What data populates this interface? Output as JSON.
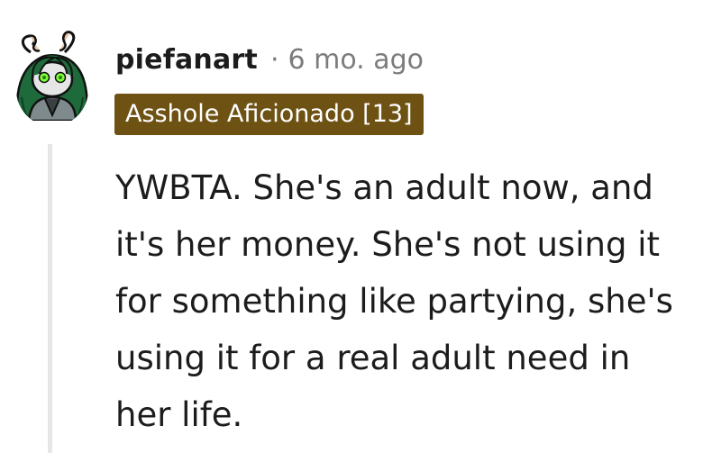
{
  "comment": {
    "author": "piefanart",
    "separator": "·",
    "timestamp": "6 mo. ago",
    "flair": {
      "text": "Asshole Aficionado [13]",
      "background": "#6e5213",
      "color": "#ffffff"
    },
    "body": "YWBTA. She's an adult now, and it's her money. She's not using it for something like partying, she's using it for a real adult need in her life."
  },
  "avatar": {
    "icon": "user-avatar-icon"
  }
}
